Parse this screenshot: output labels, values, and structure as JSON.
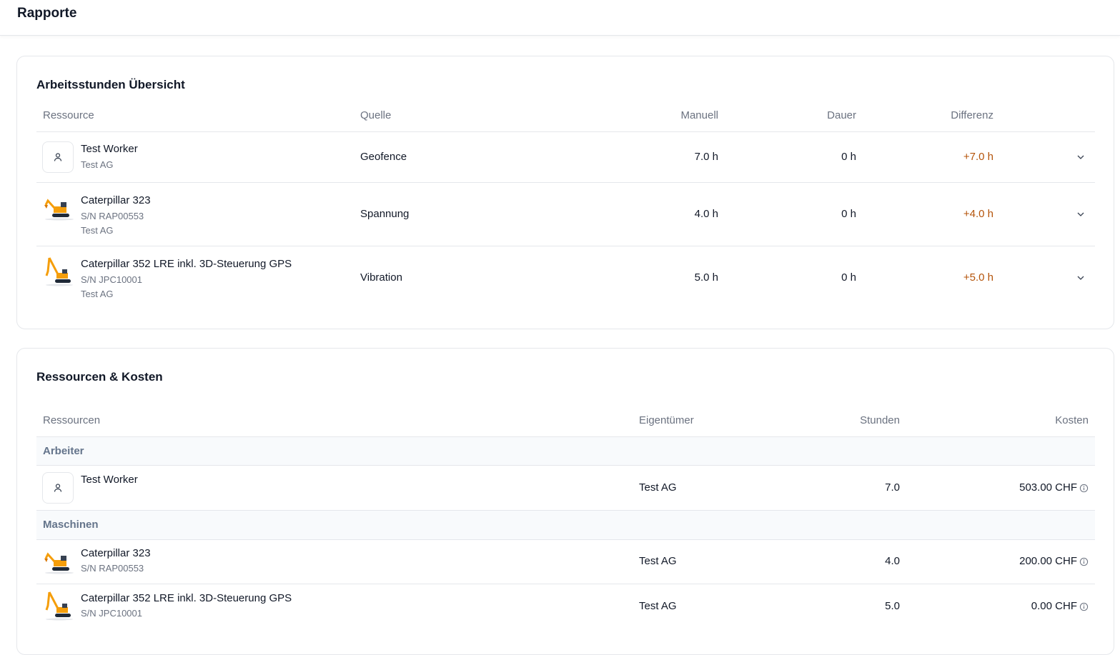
{
  "page": {
    "title": "Rapporte"
  },
  "hours": {
    "title": "Arbeitsstunden Übersicht",
    "headers": {
      "resource": "Ressource",
      "source": "Quelle",
      "manual": "Manuell",
      "duration": "Dauer",
      "difference": "Differenz"
    },
    "rows": [
      {
        "name": "Test Worker",
        "serial": "",
        "owner": "Test AG",
        "source": "Geofence",
        "manual": "7.0 h",
        "duration": "0 h",
        "difference": "+7.0 h",
        "icon": "user-icon"
      },
      {
        "name": "Caterpillar 323",
        "serial": "S/N RAP00553",
        "owner": "Test AG",
        "source": "Spannung",
        "manual": "4.0 h",
        "duration": "0 h",
        "difference": "+4.0 h",
        "icon": "excavator-icon"
      },
      {
        "name": "Caterpillar 352 LRE inkl. 3D-Steuerung GPS",
        "serial": "S/N JPC10001",
        "owner": "Test AG",
        "source": "Vibration",
        "manual": "5.0 h",
        "duration": "0 h",
        "difference": "+5.0 h",
        "icon": "long-reach-excavator-icon"
      }
    ]
  },
  "costs": {
    "title": "Ressourcen & Kosten",
    "headers": {
      "resources": "Ressourcen",
      "owner": "Eigentümer",
      "hours": "Stunden",
      "costs": "Kosten"
    },
    "groups": [
      {
        "label": "Arbeiter",
        "rows": [
          {
            "name": "Test Worker",
            "serial": "",
            "owner": "Test AG",
            "hours": "7.0",
            "cost": "503.00 CHF"
          }
        ]
      },
      {
        "label": "Maschinen",
        "rows": [
          {
            "name": "Caterpillar 323",
            "serial": "S/N RAP00553",
            "owner": "Test AG",
            "hours": "4.0",
            "cost": "200.00 CHF"
          },
          {
            "name": "Caterpillar 352 LRE inkl. 3D-Steuerung GPS",
            "serial": "S/N JPC10001",
            "owner": "Test AG",
            "hours": "5.0",
            "cost": "0.00 CHF"
          }
        ]
      }
    ]
  },
  "colors": {
    "accent_difference": "#b45309",
    "muted": "#6b7280",
    "border": "#e5e7eb"
  }
}
